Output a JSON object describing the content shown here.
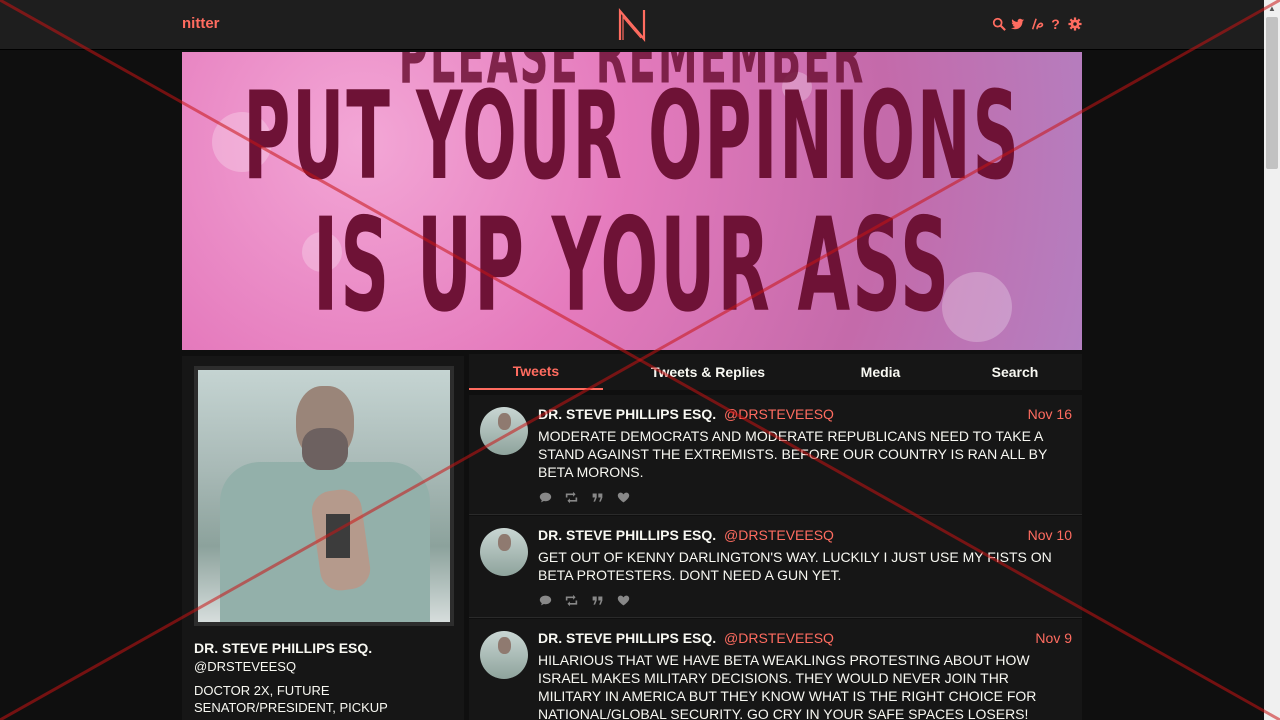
{
  "navbar": {
    "brand": "nitter",
    "logo_letter": "N",
    "icons": [
      "search-icon",
      "twitter-bird-icon",
      "rss-icon",
      "help-icon",
      "settings-gear-icon"
    ],
    "accent_color": "#ff6c60"
  },
  "banner": {
    "line_top_partial": "PLEASE REMEMBER",
    "line_1": "PUT YOUR OPINIONS",
    "line_2": "IS UP YOUR ASS"
  },
  "profile": {
    "name": "DR. STEVE PHILLIPS ESQ.",
    "handle": "@DRSTEVEESQ",
    "bio": "DOCTOR 2X, FUTURE SENATOR/PRESIDENT, PICKUP"
  },
  "tabs": [
    {
      "label": "Tweets",
      "active": true
    },
    {
      "label": "Tweets & Replies",
      "active": false
    },
    {
      "label": "Media",
      "active": false
    },
    {
      "label": "Search",
      "active": false
    }
  ],
  "tweets": [
    {
      "name": "DR. STEVE PHILLIPS ESQ.",
      "username": "@DRSTEVEESQ",
      "date": "Nov 16",
      "text": "MODERATE DEMOCRATS AND MODERATE REPUBLICANS NEED TO TAKE A STAND AGAINST THE EXTREMISTS. BEFORE OUR COUNTRY IS RAN ALL BY BETA MORONS."
    },
    {
      "name": "DR. STEVE PHILLIPS ESQ.",
      "username": "@DRSTEVEESQ",
      "date": "Nov 10",
      "text": "GET OUT OF KENNY DARLINGTON'S WAY. LUCKILY I JUST USE MY FISTS ON BETA PROTESTERS. DONT NEED A GUN YET."
    },
    {
      "name": "DR. STEVE PHILLIPS ESQ.",
      "username": "@DRSTEVEESQ",
      "date": "Nov 9",
      "text": "HILARIOUS THAT WE HAVE BETA WEAKLINGS PROTESTING ABOUT HOW ISRAEL MAKES MILITARY DECISIONS. THEY WOULD NEVER JOIN THR MILITARY IN AMERICA BUT THEY KNOW WHAT IS THE RIGHT CHOICE FOR NATIONAL/GLOBAL SECURITY. GO CRY IN YOUR SAFE SPACES LOSERS!"
    }
  ],
  "tweet_actions": [
    "comment-icon",
    "retweet-icon",
    "quote-icon",
    "heart-icon"
  ]
}
